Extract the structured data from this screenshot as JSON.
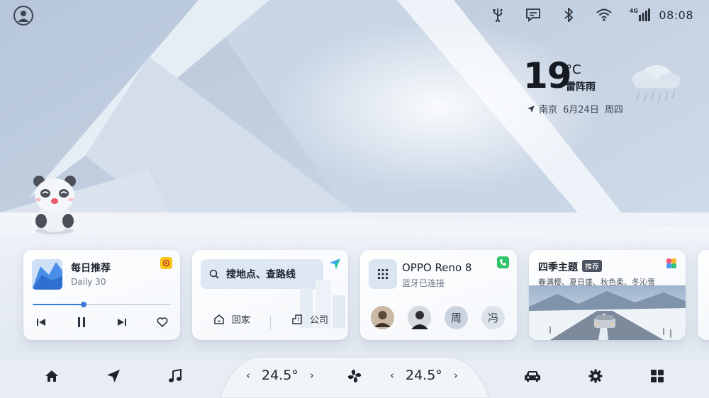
{
  "status_bar": {
    "time": "08:08",
    "network_label": "4G",
    "icons": [
      "user-icon",
      "usb-icon",
      "message-icon",
      "bluetooth-icon",
      "wifi-icon",
      "cellular-icon"
    ]
  },
  "weather": {
    "temperature": "19",
    "unit": "°C",
    "condition": "雷阵雨",
    "city": "南京",
    "date": "6月24日",
    "weekday": "周四",
    "icon": "rain-cloud-icon"
  },
  "music_card": {
    "title": "每日推荐",
    "subtitle": "Daily 30",
    "progress": 0.37,
    "controls": [
      "previous-icon",
      "pause-icon",
      "next-icon",
      "heart-icon"
    ],
    "app_color": "#f5c518"
  },
  "nav_card": {
    "search_placeholder": "搜地点、查路线",
    "home_label": "回家",
    "work_label": "公司"
  },
  "phone_card": {
    "device_name": "OPPO Reno 8",
    "status": "蓝牙已连接",
    "contacts": [
      "周",
      "冯"
    ],
    "app_color": "#2fc46b"
  },
  "theme_card": {
    "title": "四季主题",
    "badge": "推荐",
    "subtitle": "春满樱、夏日盛、秋色柔、冬沁雪"
  },
  "climate": {
    "left_temp": "24.5°",
    "right_temp": "24.5°"
  },
  "dock": {
    "items": [
      "home-icon",
      "navigation-icon",
      "music-icon",
      "fan-icon",
      "car-icon",
      "settings-icon",
      "apps-icon"
    ]
  },
  "colors": {
    "accent": "#3b7bd8",
    "background_top": "#c6d2e1",
    "background_bottom": "#e2e8f0"
  }
}
